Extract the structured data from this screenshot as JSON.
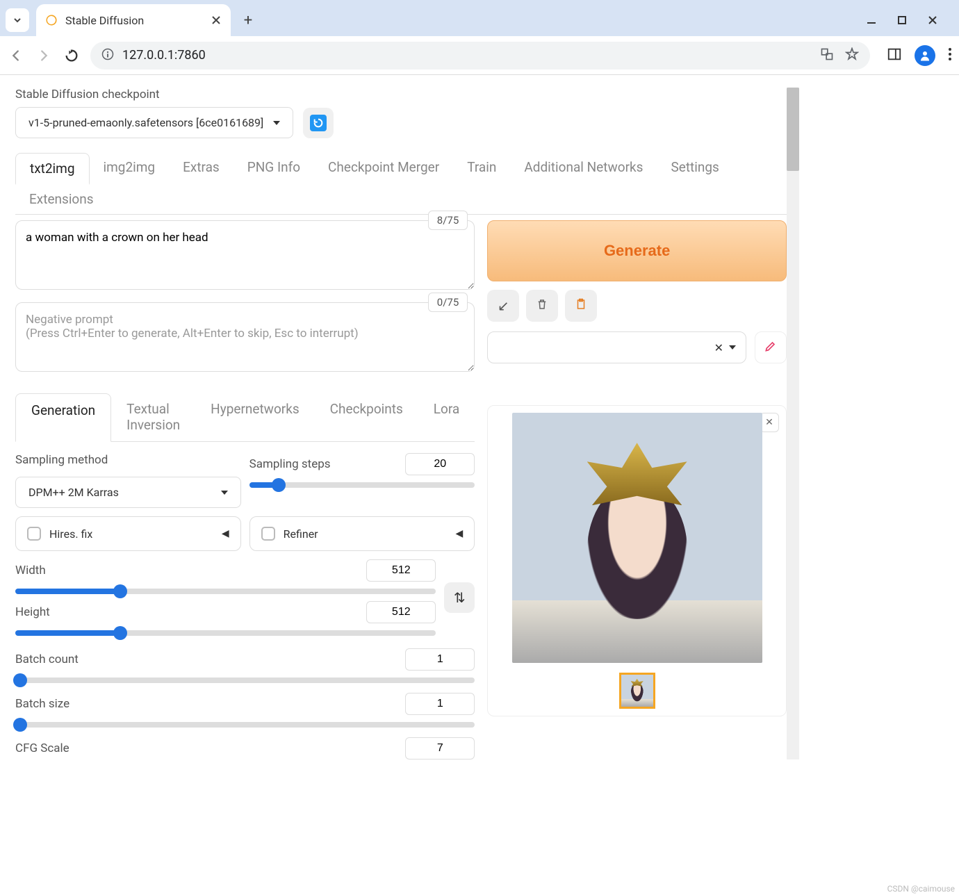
{
  "browser": {
    "tab_title": "Stable Diffusion",
    "url": "127.0.0.1:7860"
  },
  "checkpoint": {
    "label": "Stable Diffusion checkpoint",
    "value": "v1-5-pruned-emaonly.safetensors [6ce0161689]"
  },
  "tabs": {
    "items": [
      "txt2img",
      "img2img",
      "Extras",
      "PNG Info",
      "Checkpoint Merger",
      "Train",
      "Additional Networks",
      "Settings",
      "Extensions"
    ],
    "active": "txt2img"
  },
  "prompt": {
    "value": "a woman with a crown on her head",
    "tokens": "8/75"
  },
  "negative_prompt": {
    "placeholder": "Negative prompt\n(Press Ctrl+Enter to generate, Alt+Enter to skip, Esc to interrupt)",
    "tokens": "0/75"
  },
  "generate_label": "Generate",
  "styles_clear": "✕",
  "sub_tabs": {
    "items": [
      "Generation",
      "Textual Inversion",
      "Hypernetworks",
      "Checkpoints",
      "Lora"
    ],
    "active": "Generation"
  },
  "params": {
    "sampling_method": {
      "label": "Sampling method",
      "value": "DPM++ 2M Karras"
    },
    "sampling_steps": {
      "label": "Sampling steps",
      "value": "20",
      "fill_pct": 13
    },
    "hires_fix": {
      "label": "Hires. fix"
    },
    "refiner": {
      "label": "Refiner"
    },
    "width": {
      "label": "Width",
      "value": "512",
      "fill_pct": 25
    },
    "height": {
      "label": "Height",
      "value": "512",
      "fill_pct": 25
    },
    "batch_count": {
      "label": "Batch count",
      "value": "1",
      "fill_pct": 1
    },
    "batch_size": {
      "label": "Batch size",
      "value": "1",
      "fill_pct": 1
    },
    "cfg_scale": {
      "label": "CFG Scale",
      "value": "7"
    }
  },
  "watermark": "CSDN @caimouse"
}
